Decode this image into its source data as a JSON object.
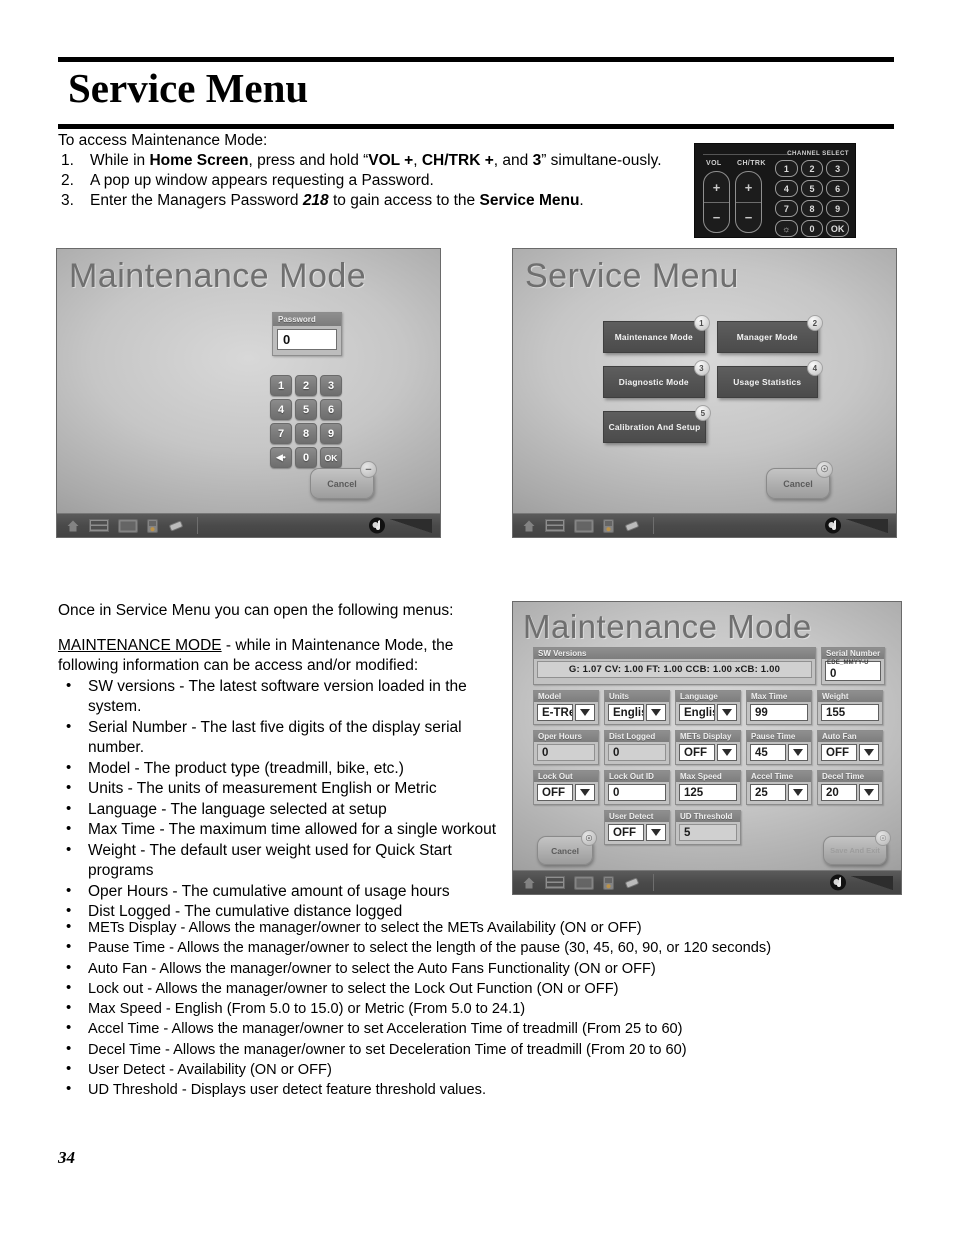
{
  "document": {
    "title": "Service Menu",
    "page_number": "34"
  },
  "intro": {
    "lead": "To access Maintenance Mode:",
    "steps": [
      {
        "parts": [
          {
            "t": "While in ",
            "s": "n"
          },
          {
            "t": "Home Screen",
            "s": "b"
          },
          {
            "t": ", press and hold “",
            "s": "n"
          },
          {
            "t": "VOL +",
            "s": "b"
          },
          {
            "t": ", ",
            "s": "n"
          },
          {
            "t": "CH/TRK +",
            "s": "b"
          },
          {
            "t": ", and ",
            "s": "n"
          },
          {
            "t": "3",
            "s": "b"
          },
          {
            "t": "” simultane-ously.",
            "s": "n"
          }
        ]
      },
      {
        "parts": [
          {
            "t": "A pop up window appears requesting a Password.",
            "s": "n"
          }
        ]
      },
      {
        "parts": [
          {
            "t": "Enter the Managers Password ",
            "s": "n"
          },
          {
            "t": "218",
            "s": "bi"
          },
          {
            "t": " to gain access to the ",
            "s": "n"
          },
          {
            "t": "Service Menu",
            "s": "b"
          },
          {
            "t": ".",
            "s": "n"
          }
        ]
      }
    ]
  },
  "console_photo": {
    "channel_select_label": "CHANNEL SELECT",
    "vol_label": "VOL",
    "chtrk_label": "CH/TRK",
    "rocker_plus": "+",
    "rocker_minus": "−",
    "keys": [
      "1",
      "2",
      "3",
      "4",
      "5",
      "6",
      "7",
      "8",
      "9",
      "☼",
      "0",
      "OK"
    ]
  },
  "device_password": {
    "title": "Maintenance Mode",
    "password_label": "Password",
    "password_value": "0",
    "keypad": [
      "1",
      "2",
      "3",
      "4",
      "5",
      "6",
      "7",
      "8",
      "9",
      "◀•",
      "0",
      "OK"
    ],
    "cancel_label": "Cancel"
  },
  "device_service": {
    "title": "Service Menu",
    "buttons": [
      {
        "label": "Maintenance Mode",
        "num": "1"
      },
      {
        "label": "Manager Mode",
        "num": "2"
      },
      {
        "label": "Diagnostic Mode",
        "num": "3"
      },
      {
        "label": "Usage Statistics",
        "num": "4"
      },
      {
        "label": "Calibration And Setup",
        "num": "5"
      }
    ],
    "cancel_label": "Cancel"
  },
  "device_maintenance": {
    "title": "Maintenance Mode",
    "sw_versions": {
      "label": "SW Versions",
      "value": "G: 1.07   CV: 1.00   FT: 1.00   CCB: 1.00   xCB: 1.00"
    },
    "serial_number": {
      "label": "Serial Number",
      "format_hint": "EDE_MMYY-U",
      "value": "0"
    },
    "fields": [
      {
        "label": "Model",
        "value": "E-TRe",
        "type": "dropdown"
      },
      {
        "label": "Units",
        "value": "English",
        "type": "dropdown"
      },
      {
        "label": "Language",
        "value": "English",
        "type": "dropdown"
      },
      {
        "label": "Max Time",
        "value": "99",
        "type": "text"
      },
      {
        "label": "Weight",
        "value": "155",
        "type": "text"
      },
      {
        "label": "Oper Hours",
        "value": "0",
        "type": "readonly"
      },
      {
        "label": "Dist Logged",
        "value": "0",
        "type": "readonly"
      },
      {
        "label": "METs Display",
        "value": "OFF",
        "type": "dropdown"
      },
      {
        "label": "Pause Time",
        "value": "45",
        "type": "dropdown"
      },
      {
        "label": "Auto Fan",
        "value": "OFF",
        "type": "dropdown"
      },
      {
        "label": "Lock Out",
        "value": "OFF",
        "type": "dropdown"
      },
      {
        "label": "Lock Out ID",
        "value": "0",
        "type": "text"
      },
      {
        "label": "Max Speed",
        "value": "125",
        "type": "text"
      },
      {
        "label": "Accel Time",
        "value": "25",
        "type": "dropdown"
      },
      {
        "label": "Decel Time",
        "value": "20",
        "type": "dropdown"
      },
      {
        "label": "User Detect",
        "value": "OFF",
        "type": "dropdown"
      },
      {
        "label": "UD Threshold",
        "value": "5",
        "type": "readonly"
      }
    ],
    "cancel_label": "Cancel",
    "save_label": "Save And Exit"
  },
  "body": {
    "intro_line": "Once in Service Menu you can open the following menus:",
    "section_heading": "MAINTENANCE MODE",
    "section_tail": "  - while in Maintenance Mode, the following information can be access and/or modified:",
    "bullets_left": [
      "SW versions - The latest software version loaded in the system.",
      "Serial Number - The last five digits of the display serial number.",
      "Model - The product type (treadmill, bike, etc.)",
      "Units - The units of measurement English or Metric",
      "Language - The language selected at setup",
      "Max Time - The maximum time allowed for a single workout",
      "Weight - The default user weight used for Quick Start programs",
      "Oper Hours - The cumulative amount of usage hours",
      "Dist Logged - The cumulative distance logged"
    ],
    "bullets_wide": [
      "METs Display - Allows the manager/owner to select the METs Availability (ON or OFF)",
      "Pause Time - Allows the manager/owner  to select the length of the pause (30, 45, 60, 90, or 120 seconds)",
      "Auto Fan - Allows the manager/owner  to select the Auto Fans Functionality (ON or OFF)",
      "Lock out - Allows the manager/owner  to select the Lock Out Function (ON or OFF)",
      "Max Speed - English (From 5.0 to 15.0)  or Metric (From 5.0 to 24.1)",
      "Accel Time - Allows the manager/owner  to set Acceleration Time of treadmill (From 25 to 60)",
      "Decel Time - Allows the manager/owner  to set Deceleration Time of treadmill (From 20 to 60)",
      "User Detect - Availability (ON or OFF)",
      "UD Threshold - Displays user detect feature threshold values."
    ]
  }
}
